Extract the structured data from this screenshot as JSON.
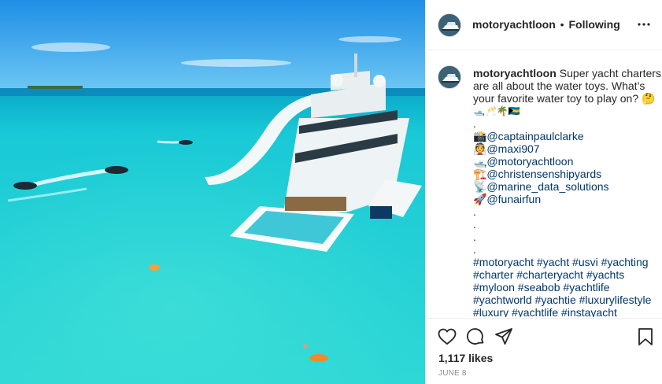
{
  "post": {
    "username": "motoryachtloon",
    "separator": "•",
    "follow_status": "Following",
    "caption": {
      "username": "motoryachtloon",
      "text_lines": [
        "Super yacht charters",
        "are all about the water toys. What’s",
        "your favorite water toy to play on? 🤔",
        "🛥️🥂🌴🇧🇸",
        ".",
        "📸@captainpaulclarke",
        "👰@maxi907",
        "🛥️@motoryachtloon",
        "🏗️@christensenshipyards",
        "📡@marine_data_solutions",
        "🚀@funairfun",
        ".",
        ".",
        ".",
        ".",
        "#motoryacht #yacht #usvi #yachting",
        "#charter #charteryacht #yachts",
        "#myloon #seabob #yachtlife",
        "#yachtworld #yachtie #luxurylifestyle",
        "#luxury #yachtlife #instayacht"
      ]
    },
    "likes": "1,117 likes",
    "date": "JUNE 8"
  },
  "icons": {
    "more": "more-options-icon",
    "like": "heart-icon",
    "comment": "comment-icon",
    "share": "share-icon",
    "save": "bookmark-icon"
  },
  "colors": {
    "link": "#00376b",
    "text": "#262626",
    "muted": "#8e8e8e",
    "border": "#efefef"
  }
}
